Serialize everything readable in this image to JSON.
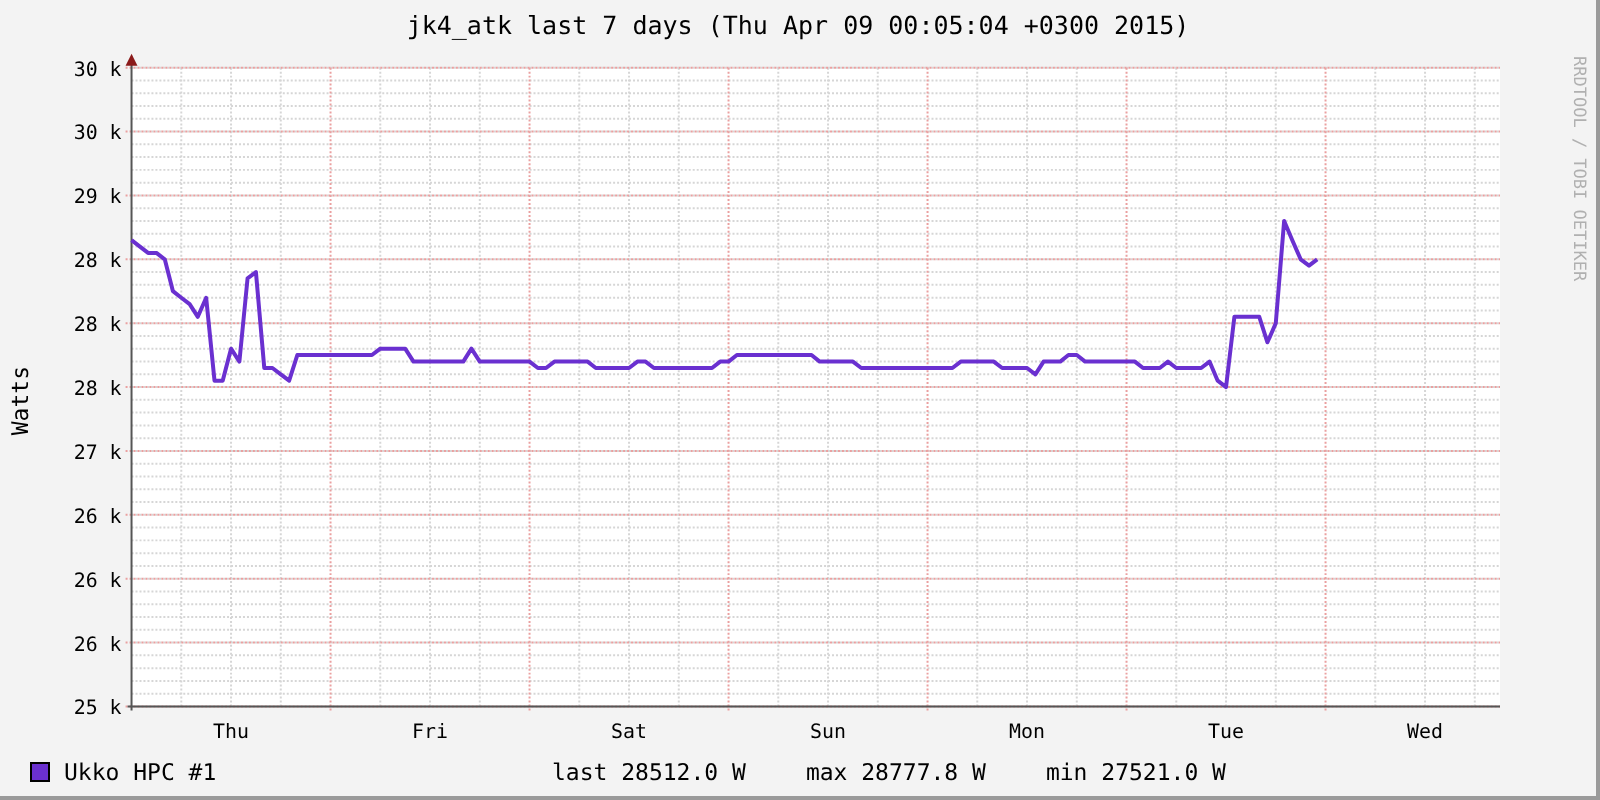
{
  "title": "jk4_atk last 7 days (Thu Apr 09 00:05:04 +0300 2015)",
  "credit": "RRDTOOL / TOBI OETIKER",
  "chart_data": {
    "type": "line",
    "grid": true,
    "ylabel": "Watts",
    "ylim": [
      25000,
      30000
    ],
    "yticks": [
      {
        "value": 25000,
        "label": "25 k"
      },
      {
        "value": 25500,
        "label": "26 k"
      },
      {
        "value": 26000,
        "label": "26 k"
      },
      {
        "value": 26500,
        "label": "26 k"
      },
      {
        "value": 27000,
        "label": "27 k"
      },
      {
        "value": 27500,
        "label": "28 k"
      },
      {
        "value": 28000,
        "label": "28 k"
      },
      {
        "value": 28500,
        "label": "28 k"
      },
      {
        "value": 29000,
        "label": "29 k"
      },
      {
        "value": 29500,
        "label": "30 k"
      },
      {
        "value": 30000,
        "label": "30 k"
      }
    ],
    "categories": [
      null,
      null,
      null,
      null,
      null,
      null,
      null,
      null,
      null,
      null,
      null,
      null,
      "Thu",
      null,
      null,
      null,
      null,
      null,
      null,
      null,
      null,
      null,
      null,
      null,
      null,
      null,
      null,
      null,
      null,
      null,
      null,
      null,
      null,
      null,
      null,
      null,
      "Fri",
      null,
      null,
      null,
      null,
      null,
      null,
      null,
      null,
      null,
      null,
      null,
      null,
      null,
      null,
      null,
      null,
      null,
      null,
      null,
      null,
      null,
      null,
      null,
      "Sat",
      null,
      null,
      null,
      null,
      null,
      null,
      null,
      null,
      null,
      null,
      null,
      null,
      null,
      null,
      null,
      null,
      null,
      null,
      null,
      null,
      null,
      null,
      null,
      "Sun",
      null,
      null,
      null,
      null,
      null,
      null,
      null,
      null,
      null,
      null,
      null,
      null,
      null,
      null,
      null,
      null,
      null,
      null,
      null,
      null,
      null,
      null,
      null,
      "Mon",
      null,
      null,
      null,
      null,
      null,
      null,
      null,
      null,
      null,
      null,
      null,
      null,
      null,
      null,
      null,
      null,
      null,
      null,
      null,
      null,
      null,
      null,
      null,
      "Tue",
      null,
      null,
      null,
      null,
      null,
      null,
      null,
      null,
      null,
      null,
      null,
      null,
      null,
      null,
      null,
      null,
      null,
      null,
      null,
      null,
      null,
      null,
      null,
      "Wed",
      null,
      null,
      null,
      null,
      null,
      null,
      null,
      null,
      null,
      null,
      null
    ],
    "series": [
      {
        "name": "Ukko HPC #1",
        "color": "#6a30d0",
        "values": [
          28650,
          28600,
          28550,
          28550,
          28500,
          28250,
          28200,
          28150,
          28050,
          28200,
          27550,
          27550,
          27800,
          27700,
          28350,
          28400,
          27650,
          27650,
          27600,
          27550,
          27750,
          27750,
          27750,
          27750,
          27750,
          27750,
          27750,
          27750,
          27750,
          27750,
          27800,
          27800,
          27800,
          27800,
          27700,
          27700,
          27700,
          27700,
          27700,
          27700,
          27700,
          27800,
          27700,
          27700,
          27700,
          27700,
          27700,
          27700,
          27700,
          27650,
          27650,
          27700,
          27700,
          27700,
          27700,
          27700,
          27650,
          27650,
          27650,
          27650,
          27650,
          27700,
          27700,
          27650,
          27650,
          27650,
          27650,
          27650,
          27650,
          27650,
          27650,
          27700,
          27700,
          27750,
          27750,
          27750,
          27750,
          27750,
          27750,
          27750,
          27750,
          27750,
          27750,
          27700,
          27700,
          27700,
          27700,
          27700,
          27650,
          27650,
          27650,
          27650,
          27650,
          27650,
          27650,
          27650,
          27650,
          27650,
          27650,
          27650,
          27700,
          27700,
          27700,
          27700,
          27700,
          27650,
          27650,
          27650,
          27650,
          27600,
          27700,
          27700,
          27700,
          27750,
          27750,
          27700,
          27700,
          27700,
          27700,
          27700,
          27700,
          27700,
          27650,
          27650,
          27650,
          27700,
          27650,
          27650,
          27650,
          27650,
          27700,
          27550,
          27500,
          28050,
          28050,
          28050,
          28050,
          27850,
          28000,
          28800,
          28650,
          28500,
          28450,
          28500,
          null,
          null,
          null,
          null,
          null,
          null,
          null,
          null,
          null,
          null,
          null,
          null,
          null,
          null,
          null,
          null,
          null,
          null,
          null,
          null,
          null,
          null,
          null,
          null
        ]
      }
    ]
  },
  "legend": {
    "stats": [
      "last 28512.0 W",
      "max 28777.8 W",
      "min 27521.0 W"
    ]
  }
}
